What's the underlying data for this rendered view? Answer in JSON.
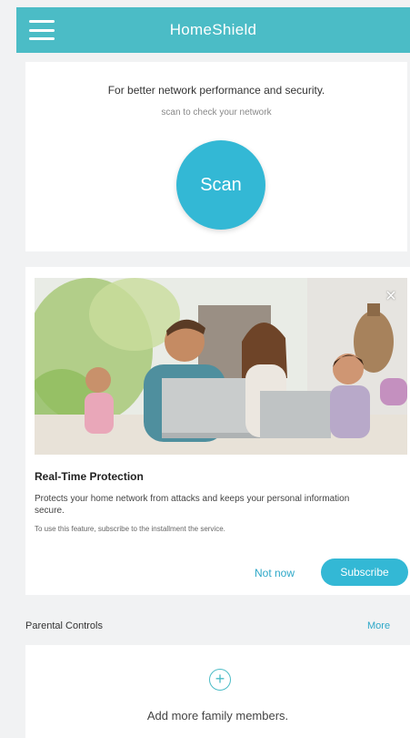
{
  "header": {
    "title": "HomeShield",
    "menu_icon": "hamburger-menu-icon",
    "bg_color": "#4bbcc6"
  },
  "scan": {
    "headline": "For better network performance and security.",
    "subtext": "scan to check your network",
    "button_label": "Scan",
    "button_color": "#33b8d5"
  },
  "protection": {
    "title": "Real-Time Protection",
    "description": "Protects your home network from attacks and keeps your personal information secure.",
    "note": "To use this feature, subscribe to the installment the service.",
    "not_now_label": "Not now",
    "subscribe_label": "Subscribe",
    "close_icon": "close-icon"
  },
  "parental": {
    "section_title": "Parental Controls",
    "more_label": "More",
    "add_label": "Add more family members.",
    "add_icon": "plus-circle-icon"
  }
}
